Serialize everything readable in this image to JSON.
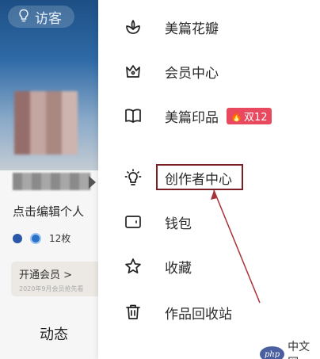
{
  "background": {
    "visitor_label": "访客",
    "edit_hint": "点击编辑个人",
    "stats_text": "12枚",
    "vip_title": "开通会员 >",
    "vip_sub": "2020年9月会员抢先看",
    "feed_tab": "动态"
  },
  "menu": {
    "items": [
      {
        "label": "美篇花瓣",
        "icon": "flower-icon"
      },
      {
        "label": "会员中心",
        "icon": "crown-icon"
      },
      {
        "label": "美篇印品",
        "icon": "book-icon",
        "badge": "双12"
      },
      {
        "label": "创作者中心",
        "icon": "lightbulb-icon",
        "highlighted": true
      },
      {
        "label": "钱包",
        "icon": "wallet-icon"
      },
      {
        "label": "收藏",
        "icon": "star-icon"
      },
      {
        "label": "作品回收站",
        "icon": "trash-icon"
      }
    ]
  },
  "watermark": {
    "logo": "php",
    "text": "中文网"
  },
  "colors": {
    "highlight_border": "#7a1f23",
    "badge": "#e8495f",
    "header": "#2f6aa6"
  }
}
